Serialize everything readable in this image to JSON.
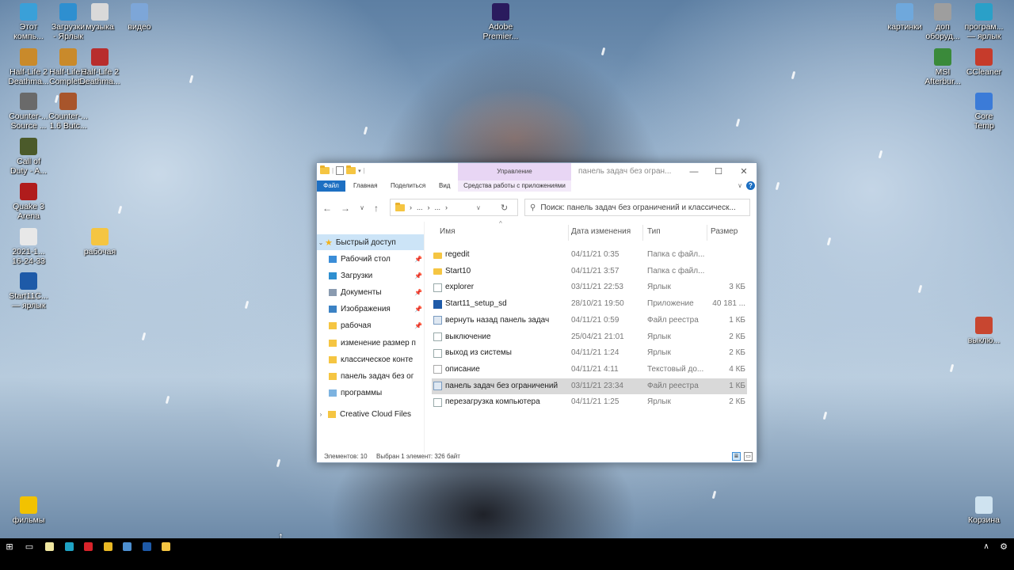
{
  "desktop": {
    "left_icons": [
      {
        "label": "Этот\nкомпь...",
        "icon": "this-pc-icon",
        "color": "#3aa0d8"
      },
      {
        "label": "Загрузки\n- Ярлык",
        "icon": "downloads-shortcut-icon",
        "color": "#2e8fd0"
      },
      {
        "label": "музыка",
        "icon": "music-folder-icon",
        "color": "#d9d9d9"
      },
      {
        "label": "видео",
        "icon": "video-folder-icon",
        "color": "#7da6d8"
      },
      {
        "label": "Half-Life 2\nDeathma...",
        "icon": "half-life-icon",
        "color": "#c98a2b"
      },
      {
        "label": "Half-Life 2\nComplet...",
        "icon": "half-life-complete-icon",
        "color": "#c98a2b"
      },
      {
        "label": "Half-Life 2\nDeathma...",
        "icon": "half-life-dm-icon",
        "color": "#b82d2d"
      },
      {
        "label": "Counter-...\nSource ...",
        "icon": "counter-strike-source-icon",
        "color": "#6a6a6a"
      },
      {
        "label": "Counter-...\n1.6 Butc...",
        "icon": "counter-strike-16-icon",
        "color": "#a8552b"
      },
      {
        "label": "Call of\nDuty - A...",
        "icon": "call-of-duty-icon",
        "color": "#4b5a2a"
      },
      {
        "label": "Quake 3\nArena",
        "icon": "quake3-icon",
        "color": "#b01c1c"
      },
      {
        "label": "2021-1...\n16-24-33",
        "icon": "screenshot-file-icon",
        "color": "#e8e8e8"
      },
      {
        "label": "Start11C...\n— ярлык",
        "icon": "start11-shortcut-icon",
        "color": "#1e5aa8"
      },
      {
        "label": "рабочая",
        "icon": "work-folder-icon",
        "color": "#f5c542"
      },
      {
        "label": "Adobe\nPremier...",
        "icon": "adobe-premiere-icon",
        "color": "#2a1b5e"
      },
      {
        "label": "фильмы",
        "icon": "warning-icon",
        "color": "#f2c200"
      }
    ],
    "right_icons": [
      {
        "label": "картинки",
        "icon": "pictures-shortcut-icon",
        "color": "#6fa8dc"
      },
      {
        "label": "доп\nоборуд...",
        "icon": "devices-icon",
        "color": "#9e9e9e"
      },
      {
        "label": "програм...\n— ярлык",
        "icon": "programs-shortcut-icon",
        "color": "#2aa0c8"
      },
      {
        "label": "MSI\nAfterbur...",
        "icon": "msi-afterburner-icon",
        "color": "#3a8a3a"
      },
      {
        "label": "CCleaner",
        "icon": "ccleaner-icon",
        "color": "#c63b2b"
      },
      {
        "label": "Core\nTemp",
        "icon": "core-temp-icon",
        "color": "#3b7bd8"
      },
      {
        "label": "выклю...",
        "icon": "shutdown-shortcut-icon",
        "color": "#c84630"
      },
      {
        "label": "Корзина",
        "icon": "recycle-bin-icon",
        "color": "#cfe3f0"
      }
    ]
  },
  "explorer": {
    "title": "панель задач без огран...",
    "manage_tab": "Управление",
    "ribbon_tabs": [
      "Файл",
      "Главная",
      "Поделиться",
      "Вид"
    ],
    "app_tools_tab": "Средства работы с приложениями",
    "address_parts": [
      "...",
      "..."
    ],
    "search_placeholder": "Поиск: панель задач без ограничений  и классическ...",
    "nav": {
      "quick_access": "Быстрый доступ",
      "items": [
        {
          "label": "Рабочий стол",
          "pinned": true,
          "icon": "desktop-icon",
          "color": "#3a8dd8"
        },
        {
          "label": "Загрузки",
          "pinned": true,
          "icon": "download-arrow-icon",
          "color": "#2e8fd0"
        },
        {
          "label": "Документы",
          "pinned": true,
          "icon": "documents-icon",
          "color": "#8a9bb0"
        },
        {
          "label": "Изображения",
          "pinned": true,
          "icon": "images-icon",
          "color": "#3b82c4"
        },
        {
          "label": "рабочая",
          "pinned": true,
          "icon": "folder-icon",
          "color": "#f5c542"
        },
        {
          "label": "изменение размер п",
          "pinned": false,
          "icon": "folder-icon",
          "color": "#f5c542"
        },
        {
          "label": "классическое конте",
          "pinned": false,
          "icon": "folder-icon",
          "color": "#f5c542"
        },
        {
          "label": "панель задач без ог",
          "pinned": false,
          "icon": "folder-icon",
          "color": "#f5c542"
        },
        {
          "label": "программы",
          "pinned": false,
          "icon": "programs-folder-icon",
          "color": "#7db3e0"
        }
      ],
      "creative_cloud": "Creative Cloud Files"
    },
    "columns": {
      "name": "Имя",
      "date": "Дата изменения",
      "type": "Тип",
      "size": "Размер"
    },
    "files": [
      {
        "name": "regedit",
        "date": "04/11/21 0:35",
        "type": "Папка с файл...",
        "size": "",
        "icon": "folder"
      },
      {
        "name": "Start10",
        "date": "04/11/21 3:57",
        "type": "Папка с файл...",
        "size": "",
        "icon": "folder"
      },
      {
        "name": "explorer",
        "date": "03/11/21 22:53",
        "type": "Ярлык",
        "size": "3 КБ",
        "icon": "lnk"
      },
      {
        "name": "Start11_setup_sd",
        "date": "28/10/21 19:50",
        "type": "Приложение",
        "size": "40 181 ...",
        "icon": "exe"
      },
      {
        "name": "вернуть назад панель задач",
        "date": "04/11/21 0:59",
        "type": "Файл реестра",
        "size": "1 КБ",
        "icon": "reg"
      },
      {
        "name": "выключение",
        "date": "25/04/21 21:01",
        "type": "Ярлык",
        "size": "2 КБ",
        "icon": "lnk"
      },
      {
        "name": "выход из системы",
        "date": "04/11/21 1:24",
        "type": "Ярлык",
        "size": "2 КБ",
        "icon": "lnk"
      },
      {
        "name": "описание",
        "date": "04/11/21 4:11",
        "type": "Текстовый до...",
        "size": "4 КБ",
        "icon": "txt"
      },
      {
        "name": "панель задач без ограничений",
        "date": "03/11/21 23:34",
        "type": "Файл реестра",
        "size": "1 КБ",
        "icon": "reg",
        "selected": true
      },
      {
        "name": "перезагрузка компьютера",
        "date": "04/11/21 1:25",
        "type": "Ярлык",
        "size": "2 КБ",
        "icon": "lnk"
      }
    ],
    "status": {
      "count": "Элементов: 10",
      "selected": "Выбран 1 элемент: 326 байт"
    }
  },
  "taskbar": {
    "items": [
      {
        "name": "start-button",
        "glyph": "⊞",
        "color": "#ffffff"
      },
      {
        "name": "task-view-button",
        "glyph": "▭",
        "color": "#ffffff"
      },
      {
        "name": "notepad-button",
        "glyph": "",
        "color": "#f0e6a0"
      },
      {
        "name": "photo-app-button",
        "glyph": "",
        "color": "#1fa3c4"
      },
      {
        "name": "opera-button",
        "glyph": "",
        "color": "#d8232a"
      },
      {
        "name": "chrome-button",
        "glyph": "",
        "color": "#e9b824"
      },
      {
        "name": "edge-button",
        "glyph": "",
        "color": "#4d8fd0"
      },
      {
        "name": "start11-button",
        "glyph": "",
        "color": "#1e5aa8"
      },
      {
        "name": "file-explorer-button",
        "glyph": "",
        "color": "#f5c542"
      }
    ]
  }
}
